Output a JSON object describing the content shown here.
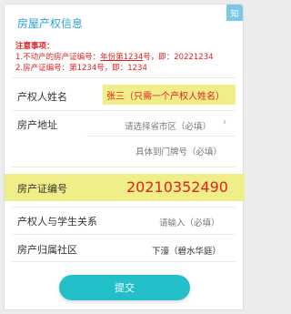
{
  "header": {
    "title": "房屋产权信息",
    "corner_badge": "知"
  },
  "notes": {
    "heading": "注意事项：",
    "line1_prefix": "1.不动产的房产证编号：",
    "line1_underlined": "年份第1234",
    "line1_suffix": "号，即：20221234",
    "line2": "2.房产证编号：第1234号，即：1234"
  },
  "form": {
    "owner_name": {
      "label": "产权人姓名",
      "value": "张三（只需一个产权人姓名）"
    },
    "address": {
      "label": "房产地址",
      "placeholder": "请选择省市区（必填）",
      "detail_placeholder": "具体到门牌号（必填）"
    },
    "cert_number": {
      "label": "房产证编号",
      "value": "20210352490"
    },
    "relation": {
      "label": "产权人与学生关系",
      "placeholder": "请输入（必填）"
    },
    "community": {
      "label": "房产归属社区",
      "value": "下濠（碧水华庭）"
    }
  },
  "submit_label": "提交",
  "colors": {
    "accent": "#2aa6d8",
    "warning": "#e02020",
    "highlight": "#f0ee88",
    "button": "#22bfc9"
  },
  "icons": {
    "chevron": "chevron-right-icon"
  }
}
